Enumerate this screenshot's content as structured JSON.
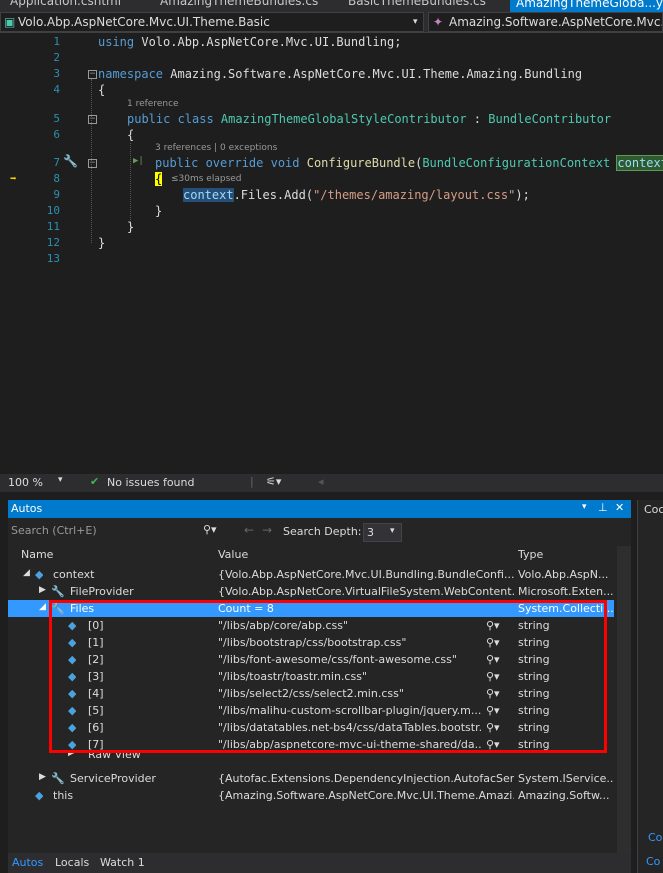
{
  "tabs": [
    "Application.cshtml",
    "AmazingThemeBundles.cs",
    "BasicThemeBundles.cs",
    "AmazingThemeGloba...yleContributor.cs"
  ],
  "nav": {
    "project": "Volo.Abp.AspNetCore.Mvc.UI.Theme.Basic",
    "member": "Amazing.Software.AspNetCore.Mvc.UI.T"
  },
  "line_numbers": [
    "1",
    "2",
    "3",
    "4",
    "5",
    "6",
    "7",
    "8",
    "9",
    "10",
    "11",
    "12",
    "13"
  ],
  "code": {
    "l1_kw": "using",
    "l1_rest": " Volo.Abp.AspNetCore.Mvc.UI.Bundling;",
    "l3_kw": "namespace",
    "l3_rest": " Amazing.Software.AspNetCore.Mvc.UI.Theme.Amazing.Bundling",
    "brace_open": "{",
    "brace_close": "}",
    "lens_class": "1 reference",
    "l5_kw": "public class ",
    "l5_type": "AmazingThemeGlobalStyleContributor",
    "l5_colon": " : ",
    "l5_base": "BundleContributor",
    "lens_method": "3 references | 0 exceptions",
    "l7_kw": "public override void ",
    "l7_fn": "ConfigureBundle",
    "l7_p1": "(",
    "l7_ptype": "BundleConfigurationContext",
    "l7_space": " ",
    "l7_param": "context",
    "l7_p2": ")",
    "elapsed": "≤30ms elapsed",
    "l9_obj": "context",
    "l9_mid": ".Files.Add(",
    "l9_str": "\"/themes/amazing/layout.css\"",
    "l9_end": ");"
  },
  "status": {
    "zoom": "100 %",
    "issues": "No issues found"
  },
  "autos": {
    "title": "Autos",
    "search_placeholder": "Search (Ctrl+E)",
    "depth_label": "Search Depth:",
    "depth_value": "3",
    "columns": [
      "Name",
      "Value",
      "Type"
    ],
    "rows": [
      {
        "name": "context",
        "value": "{Volo.Abp.AspNetCore.Mvc.UI.Bundling.BundleConfi...",
        "type": "Volo.Abp.AspN..."
      },
      {
        "name": "FileProvider",
        "value": "{Volo.Abp.AspNetCore.VirtualFileSystem.WebContent...",
        "type": "Microsoft.Exten..."
      },
      {
        "name": "Files",
        "value": "Count = 8",
        "type": "System.Collecti..."
      },
      {
        "name": "[0]",
        "value": "\"/libs/abp/core/abp.css\"",
        "type": "string"
      },
      {
        "name": "[1]",
        "value": "\"/libs/bootstrap/css/bootstrap.css\"",
        "type": "string"
      },
      {
        "name": "[2]",
        "value": "\"/libs/font-awesome/css/font-awesome.css\"",
        "type": "string"
      },
      {
        "name": "[3]",
        "value": "\"/libs/toastr/toastr.min.css\"",
        "type": "string"
      },
      {
        "name": "[4]",
        "value": "\"/libs/select2/css/select2.min.css\"",
        "type": "string"
      },
      {
        "name": "[5]",
        "value": "\"/libs/malihu-custom-scrollbar-plugin/jquery.m...",
        "type": "string"
      },
      {
        "name": "[6]",
        "value": "\"/libs/datatables.net-bs4/css/dataTables.bootstr...",
        "type": "string"
      },
      {
        "name": "[7]",
        "value": "\"/libs/abp/aspnetcore-mvc-ui-theme-shared/da...",
        "type": "string"
      },
      {
        "name": "Raw View",
        "value": "",
        "type": ""
      },
      {
        "name": "ServiceProvider",
        "value": "{Autofac.Extensions.DependencyInjection.AutofacSer...",
        "type": "System.IService..."
      },
      {
        "name": "this",
        "value": "{Amazing.Software.AspNetCore.Mvc.UI.Theme.Amazi...",
        "type": "Amazing.Softw..."
      }
    ]
  },
  "bottom_tabs": [
    "Autos",
    "Locals",
    "Watch 1"
  ],
  "right_pane": {
    "head": "Coc",
    "foot1": "Co",
    "foot2": "Co"
  },
  "colors": {
    "accent": "#007acc",
    "highlight": "#ff0000",
    "selection": "#3399ff"
  }
}
